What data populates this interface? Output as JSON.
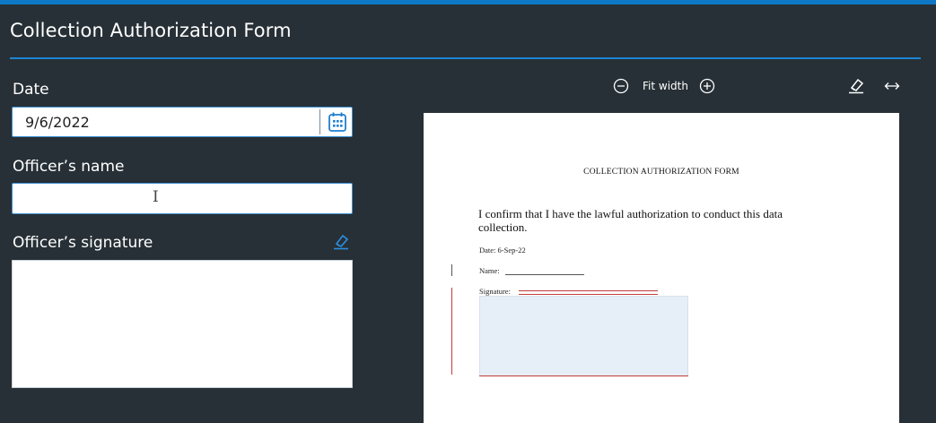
{
  "app": {
    "title": "Collection Authorization Form"
  },
  "form": {
    "date_label": "Date",
    "date_value": "9/6/2022",
    "officer_name_label": "Officer’s name",
    "officer_name_value": "",
    "officer_signature_label": "Officer’s signature"
  },
  "preview_toolbar": {
    "zoom_out_icon": "minus-circle-icon",
    "fit_width_label": "Fit width",
    "zoom_in_icon": "plus-circle-icon",
    "erase_icon": "eraser-icon",
    "expand_icon": "horizontal-arrows-icon"
  },
  "document": {
    "heading": "COLLECTION AUTHORIZATION FORM",
    "confirm_text": "I confirm that I have the lawful authorization to conduct this data collection.",
    "date_line": "Date: 6-Sep-22",
    "name_label": "Name:",
    "signature_label": "Signature:"
  },
  "colors": {
    "background": "#273036",
    "accent": "#0e78c6",
    "input_border": "#3d8fd1",
    "signature_highlight": "#e6eef8"
  }
}
